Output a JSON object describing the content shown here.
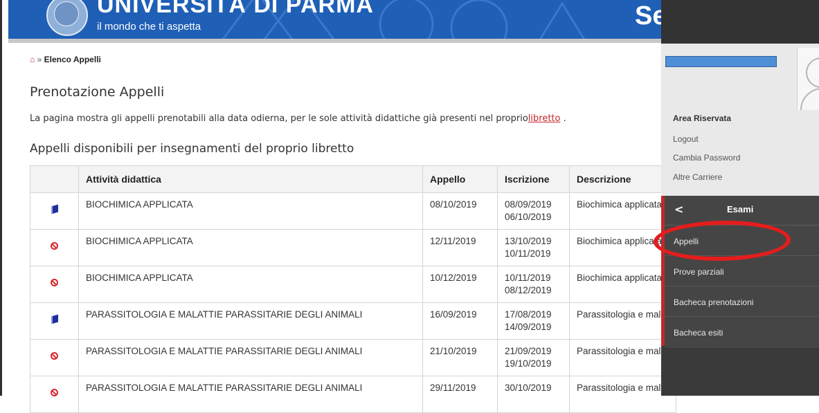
{
  "header": {
    "title": "UNIVERSITÀ DI PARMA",
    "subtitle": "il mondo che ti aspetta",
    "right_text": "Se"
  },
  "breadcrumb": {
    "home_icon": "home-icon",
    "separator": "»",
    "current": "Elenco Appelli"
  },
  "page": {
    "title": "Prenotazione Appelli",
    "intro_text": "La pagina mostra gli appelli prenotabili alla data odierna, per le sole attività didattiche già presenti nel proprio",
    "intro_link": "libretto",
    "intro_end": " .",
    "section_title": "Appelli disponibili per insegnamenti del proprio libretto"
  },
  "table": {
    "headers": [
      "",
      "Attività didattica",
      "Appello",
      "Iscrizione",
      "Descrizione"
    ],
    "rows": [
      {
        "icon": "book-icon",
        "attivita": "BIOCHIMICA APPLICATA",
        "appello": "08/10/2019",
        "iscrizione_da": "08/09/2019",
        "iscrizione_a": "06/10/2019",
        "descrizione": "Biochimica applicata"
      },
      {
        "icon": "block-icon",
        "attivita": "BIOCHIMICA APPLICATA",
        "appello": "12/11/2019",
        "iscrizione_da": "13/10/2019",
        "iscrizione_a": "10/11/2019",
        "descrizione": "Biochimica applicata"
      },
      {
        "icon": "block-icon",
        "attivita": "BIOCHIMICA APPLICATA",
        "appello": "10/12/2019",
        "iscrizione_da": "10/11/2019",
        "iscrizione_a": "08/12/2019",
        "descrizione": "Biochimica applicata"
      },
      {
        "icon": "book-icon",
        "attivita": "PARASSITOLOGIA E MALATTIE PARASSITARIE DEGLI ANIMALI",
        "appello": "16/09/2019",
        "iscrizione_da": "17/08/2019",
        "iscrizione_a": "14/09/2019",
        "descrizione": "Parassitologia e malat"
      },
      {
        "icon": "block-icon",
        "attivita": "PARASSITOLOGIA E MALATTIE PARASSITARIE DEGLI ANIMALI",
        "appello": "21/10/2019",
        "iscrizione_da": "21/09/2019",
        "iscrizione_a": "19/10/2019",
        "descrizione": "Parassitologia e malat"
      },
      {
        "icon": "block-icon",
        "attivita": "PARASSITOLOGIA E MALATTIE PARASSITARIE DEGLI ANIMALI",
        "appello": "29/11/2019",
        "iscrizione_da": "30/10/2019",
        "iscrizione_a": "",
        "descrizione": "Parassitologia e malat"
      }
    ]
  },
  "sidebar": {
    "area_title": "Area Riservata",
    "links": [
      "Logout",
      "Cambia Password",
      "Altre Carriere"
    ],
    "menu_title": "Esami",
    "back_icon": "chevron-left-icon",
    "menu_items": [
      "Appelli",
      "Prove parziali",
      "Bacheca prenotazioni",
      "Bacheca esiti"
    ]
  },
  "colors": {
    "header_blue": "#1f5fb6",
    "accent_red": "#c0282d",
    "highlight_ring": "#e31d1d",
    "panel_dark": "#454545"
  }
}
